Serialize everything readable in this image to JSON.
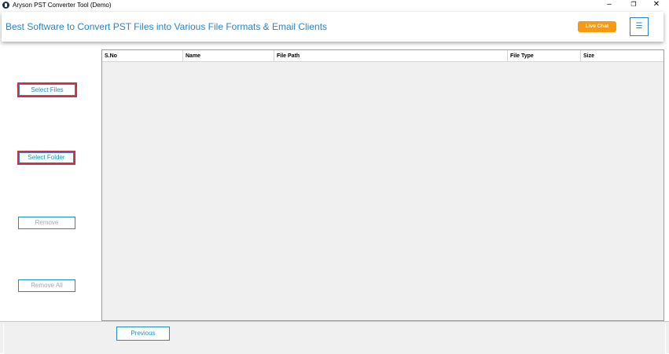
{
  "window": {
    "title": "Aryson PST Converter Tool (Demo)",
    "minimize_glyph": "–",
    "maximize_glyph": "❐",
    "close_glyph": "✕"
  },
  "header": {
    "title": "Best Software to Convert PST Files into Various File Formats & Email Clients",
    "live_chat_label": "Live Chat",
    "menu_glyph": "☰",
    "accent_color": "#2b84c4",
    "live_chat_color": "#f79a10"
  },
  "sidebar": {
    "select_files_label": "Select Files",
    "select_folder_label": "Select Folder",
    "remove_label": "Remove",
    "remove_all_label": "Remove All"
  },
  "table": {
    "columns": [
      "S.No",
      "Name",
      "File Path",
      "File Type",
      "Size"
    ],
    "rows": []
  },
  "footer": {
    "previous_label": "Previous"
  }
}
